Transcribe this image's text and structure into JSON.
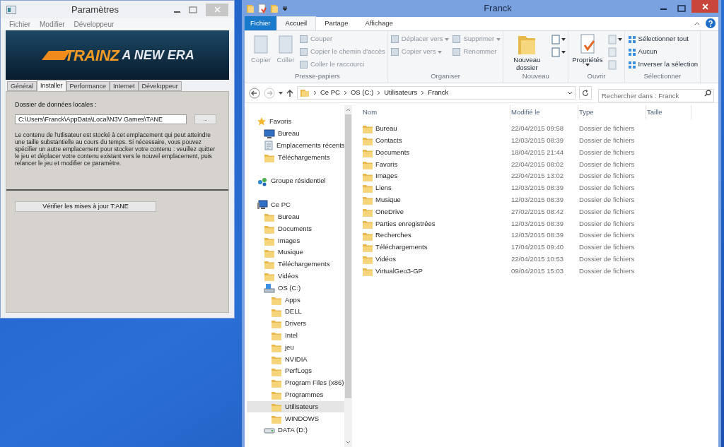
{
  "settings_window": {
    "title": "Paramètres",
    "menu": [
      "Fichier",
      "Modifier",
      "Développeur"
    ],
    "banner": {
      "logo": "TRAINZ",
      "tagline": "A NEW ERA"
    },
    "tabs": [
      {
        "label": "Général",
        "selected": false
      },
      {
        "label": "Installer",
        "selected": true
      },
      {
        "label": "Performance",
        "selected": false
      },
      {
        "label": "Internet",
        "selected": false
      },
      {
        "label": "Développeur",
        "selected": false
      }
    ],
    "folder_label": "Dossier de données locales :",
    "folder_value": "C:\\Users\\Franck\\AppData\\Local\\N3V Games\\TANE",
    "browse_button": "...",
    "description": "Le contenu de l'utlisateur est stocké à cet emplacement qui peut atteindre une taille substantielle au cours du temps. Si nécessaire, vous pouvez spécifier un autre emplacement pour stocker votre contenu : veuillez quitter le jeu et déplacer votre contenu existant vers le nouvel emplacement, puis relancer le jeu et modifier ce paramètre.",
    "update_button": "Vérifier les mises à jour T:ANE"
  },
  "explorer": {
    "title": "Franck",
    "ribbon_tabs": [
      {
        "label": "Fichier",
        "kind": "file",
        "selected": false
      },
      {
        "label": "Accueil",
        "kind": "tab",
        "selected": true
      },
      {
        "label": "Partage",
        "kind": "tab",
        "selected": false
      },
      {
        "label": "Affichage",
        "kind": "tab",
        "selected": false
      }
    ],
    "ribbon_groups": [
      {
        "label": "Presse-papiers",
        "columns": [
          [
            {
              "label": "Copier",
              "kind": "large",
              "disabled": true
            }
          ],
          [
            {
              "label": "Coller",
              "kind": "large",
              "disabled": true
            }
          ],
          [
            {
              "label": "Couper",
              "kind": "small",
              "disabled": true
            },
            {
              "label": "Copier le chemin d'accès",
              "kind": "small",
              "disabled": true
            },
            {
              "label": "Coller le raccourci",
              "kind": "small",
              "disabled": true
            }
          ]
        ]
      },
      {
        "label": "Organiser",
        "columns": [
          [
            {
              "label": "Déplacer vers",
              "kind": "small",
              "disabled": true,
              "dropdown": true
            },
            {
              "label": "Copier vers",
              "kind": "small",
              "disabled": true,
              "dropdown": true
            }
          ],
          [
            {
              "label": "Supprimer",
              "kind": "small",
              "disabled": true,
              "dropdown": true
            },
            {
              "label": "Renommer",
              "kind": "small",
              "disabled": true
            }
          ]
        ]
      },
      {
        "label": "Nouveau",
        "columns": [
          [
            {
              "label": "Nouveau dossier",
              "kind": "large",
              "disabled": false
            }
          ],
          [
            {
              "kind": "icon",
              "disabled": false,
              "dropdown": true
            },
            {
              "kind": "icon",
              "disabled": false,
              "dropdown": true
            }
          ]
        ]
      },
      {
        "label": "Ouvrir",
        "columns": [
          [
            {
              "label": "Propriétés",
              "kind": "large",
              "disabled": false,
              "dropdown": true
            }
          ],
          [
            {
              "kind": "icon",
              "disabled": true,
              "dropdown": true
            },
            {
              "kind": "icon",
              "disabled": true
            },
            {
              "kind": "icon",
              "disabled": true
            }
          ]
        ]
      },
      {
        "label": "Sélectionner",
        "columns": [
          [
            {
              "label": "Sélectionner tout",
              "kind": "small",
              "disabled": false
            },
            {
              "label": "Aucun",
              "kind": "small",
              "disabled": false
            },
            {
              "label": "Inverser la sélection",
              "kind": "small",
              "disabled": false
            }
          ]
        ]
      }
    ],
    "breadcrumb": [
      "Ce PC",
      "OS (C:)",
      "Utilisateurs",
      "Franck"
    ],
    "search_placeholder": "Rechercher dans : Franck",
    "nav_tree": [
      {
        "label": "Favoris",
        "kind": "star",
        "selected": false,
        "children": [
          {
            "label": "Bureau",
            "kind": "desktop",
            "selected": false
          },
          {
            "label": "Emplacements récents",
            "kind": "recent",
            "selected": false
          },
          {
            "label": "Téléchargements",
            "kind": "folder",
            "selected": false
          }
        ]
      },
      {
        "label": "Groupe résidentiel",
        "kind": "group",
        "selected": false
      },
      {
        "label": "Ce PC",
        "kind": "pc",
        "selected": false,
        "children": [
          {
            "label": "Bureau",
            "kind": "folder",
            "selected": false
          },
          {
            "label": "Documents",
            "kind": "folder",
            "selected": false
          },
          {
            "label": "Images",
            "kind": "folder",
            "selected": false
          },
          {
            "label": "Musique",
            "kind": "folder",
            "selected": false
          },
          {
            "label": "Téléchargements",
            "kind": "folder",
            "selected": false
          },
          {
            "label": "Vidéos",
            "kind": "folder",
            "selected": false
          },
          {
            "label": "OS (C:)",
            "kind": "drive",
            "selected": false,
            "children": [
              {
                "label": "Apps",
                "kind": "folder",
                "selected": false
              },
              {
                "label": "DELL",
                "kind": "folder",
                "selected": false
              },
              {
                "label": "Drivers",
                "kind": "folder",
                "selected": false
              },
              {
                "label": "Intel",
                "kind": "folder",
                "selected": false
              },
              {
                "label": "jeu",
                "kind": "folder",
                "selected": false
              },
              {
                "label": "NVIDIA",
                "kind": "folder",
                "selected": false
              },
              {
                "label": "PerfLogs",
                "kind": "folder",
                "selected": false
              },
              {
                "label": "Program Files (x86)",
                "kind": "folder",
                "selected": false
              },
              {
                "label": "Programmes",
                "kind": "folder",
                "selected": false
              },
              {
                "label": "Utilisateurs",
                "kind": "folder",
                "selected": true
              },
              {
                "label": "WINDOWS",
                "kind": "folder",
                "selected": false
              }
            ]
          },
          {
            "label": "DATA (D:)",
            "kind": "disk",
            "selected": false
          }
        ]
      }
    ],
    "columns": [
      "Nom",
      "Modifié le",
      "Type",
      "Taille"
    ],
    "files": [
      {
        "name": "Bureau",
        "modified": "22/04/2015 09:58",
        "type": "Dossier de fichiers"
      },
      {
        "name": "Contacts",
        "modified": "12/03/2015 08:39",
        "type": "Dossier de fichiers"
      },
      {
        "name": "Documents",
        "modified": "18/04/2015 21:44",
        "type": "Dossier de fichiers"
      },
      {
        "name": "Favoris",
        "modified": "22/04/2015 08:02",
        "type": "Dossier de fichiers"
      },
      {
        "name": "Images",
        "modified": "22/04/2015 13:02",
        "type": "Dossier de fichiers"
      },
      {
        "name": "Liens",
        "modified": "12/03/2015 08:39",
        "type": "Dossier de fichiers"
      },
      {
        "name": "Musique",
        "modified": "12/03/2015 08:39",
        "type": "Dossier de fichiers"
      },
      {
        "name": "OneDrive",
        "modified": "27/02/2015 08:42",
        "type": "Dossier de fichiers"
      },
      {
        "name": "Parties enregistrées",
        "modified": "12/03/2015 08:39",
        "type": "Dossier de fichiers"
      },
      {
        "name": "Recherches",
        "modified": "12/03/2015 08:39",
        "type": "Dossier de fichiers"
      },
      {
        "name": "Téléchargements",
        "modified": "17/04/2015 09:40",
        "type": "Dossier de fichiers"
      },
      {
        "name": "Vidéos",
        "modified": "22/04/2015 10:53",
        "type": "Dossier de fichiers"
      },
      {
        "name": "VirtualGeo3-GP",
        "modified": "09/04/2015 15:03",
        "type": "Dossier de fichiers"
      }
    ]
  }
}
